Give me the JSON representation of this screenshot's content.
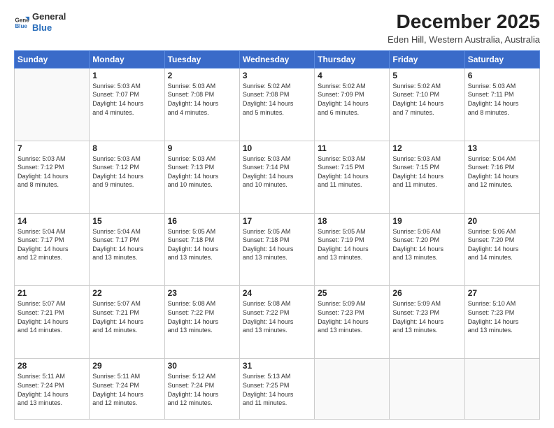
{
  "header": {
    "logo_general": "General",
    "logo_blue": "Blue",
    "title": "December 2025",
    "subtitle": "Eden Hill, Western Australia, Australia"
  },
  "calendar": {
    "days_of_week": [
      "Sunday",
      "Monday",
      "Tuesday",
      "Wednesday",
      "Thursday",
      "Friday",
      "Saturday"
    ],
    "weeks": [
      [
        {
          "day": "",
          "info": ""
        },
        {
          "day": "1",
          "info": "Sunrise: 5:03 AM\nSunset: 7:07 PM\nDaylight: 14 hours\nand 4 minutes."
        },
        {
          "day": "2",
          "info": "Sunrise: 5:03 AM\nSunset: 7:08 PM\nDaylight: 14 hours\nand 4 minutes."
        },
        {
          "day": "3",
          "info": "Sunrise: 5:02 AM\nSunset: 7:08 PM\nDaylight: 14 hours\nand 5 minutes."
        },
        {
          "day": "4",
          "info": "Sunrise: 5:02 AM\nSunset: 7:09 PM\nDaylight: 14 hours\nand 6 minutes."
        },
        {
          "day": "5",
          "info": "Sunrise: 5:02 AM\nSunset: 7:10 PM\nDaylight: 14 hours\nand 7 minutes."
        },
        {
          "day": "6",
          "info": "Sunrise: 5:03 AM\nSunset: 7:11 PM\nDaylight: 14 hours\nand 8 minutes."
        }
      ],
      [
        {
          "day": "7",
          "info": "Sunrise: 5:03 AM\nSunset: 7:12 PM\nDaylight: 14 hours\nand 8 minutes."
        },
        {
          "day": "8",
          "info": "Sunrise: 5:03 AM\nSunset: 7:12 PM\nDaylight: 14 hours\nand 9 minutes."
        },
        {
          "day": "9",
          "info": "Sunrise: 5:03 AM\nSunset: 7:13 PM\nDaylight: 14 hours\nand 10 minutes."
        },
        {
          "day": "10",
          "info": "Sunrise: 5:03 AM\nSunset: 7:14 PM\nDaylight: 14 hours\nand 10 minutes."
        },
        {
          "day": "11",
          "info": "Sunrise: 5:03 AM\nSunset: 7:15 PM\nDaylight: 14 hours\nand 11 minutes."
        },
        {
          "day": "12",
          "info": "Sunrise: 5:03 AM\nSunset: 7:15 PM\nDaylight: 14 hours\nand 11 minutes."
        },
        {
          "day": "13",
          "info": "Sunrise: 5:04 AM\nSunset: 7:16 PM\nDaylight: 14 hours\nand 12 minutes."
        }
      ],
      [
        {
          "day": "14",
          "info": "Sunrise: 5:04 AM\nSunset: 7:17 PM\nDaylight: 14 hours\nand 12 minutes."
        },
        {
          "day": "15",
          "info": "Sunrise: 5:04 AM\nSunset: 7:17 PM\nDaylight: 14 hours\nand 13 minutes."
        },
        {
          "day": "16",
          "info": "Sunrise: 5:05 AM\nSunset: 7:18 PM\nDaylight: 14 hours\nand 13 minutes."
        },
        {
          "day": "17",
          "info": "Sunrise: 5:05 AM\nSunset: 7:18 PM\nDaylight: 14 hours\nand 13 minutes."
        },
        {
          "day": "18",
          "info": "Sunrise: 5:05 AM\nSunset: 7:19 PM\nDaylight: 14 hours\nand 13 minutes."
        },
        {
          "day": "19",
          "info": "Sunrise: 5:06 AM\nSunset: 7:20 PM\nDaylight: 14 hours\nand 13 minutes."
        },
        {
          "day": "20",
          "info": "Sunrise: 5:06 AM\nSunset: 7:20 PM\nDaylight: 14 hours\nand 14 minutes."
        }
      ],
      [
        {
          "day": "21",
          "info": "Sunrise: 5:07 AM\nSunset: 7:21 PM\nDaylight: 14 hours\nand 14 minutes."
        },
        {
          "day": "22",
          "info": "Sunrise: 5:07 AM\nSunset: 7:21 PM\nDaylight: 14 hours\nand 14 minutes."
        },
        {
          "day": "23",
          "info": "Sunrise: 5:08 AM\nSunset: 7:22 PM\nDaylight: 14 hours\nand 13 minutes."
        },
        {
          "day": "24",
          "info": "Sunrise: 5:08 AM\nSunset: 7:22 PM\nDaylight: 14 hours\nand 13 minutes."
        },
        {
          "day": "25",
          "info": "Sunrise: 5:09 AM\nSunset: 7:23 PM\nDaylight: 14 hours\nand 13 minutes."
        },
        {
          "day": "26",
          "info": "Sunrise: 5:09 AM\nSunset: 7:23 PM\nDaylight: 14 hours\nand 13 minutes."
        },
        {
          "day": "27",
          "info": "Sunrise: 5:10 AM\nSunset: 7:23 PM\nDaylight: 14 hours\nand 13 minutes."
        }
      ],
      [
        {
          "day": "28",
          "info": "Sunrise: 5:11 AM\nSunset: 7:24 PM\nDaylight: 14 hours\nand 13 minutes."
        },
        {
          "day": "29",
          "info": "Sunrise: 5:11 AM\nSunset: 7:24 PM\nDaylight: 14 hours\nand 12 minutes."
        },
        {
          "day": "30",
          "info": "Sunrise: 5:12 AM\nSunset: 7:24 PM\nDaylight: 14 hours\nand 12 minutes."
        },
        {
          "day": "31",
          "info": "Sunrise: 5:13 AM\nSunset: 7:25 PM\nDaylight: 14 hours\nand 11 minutes."
        },
        {
          "day": "",
          "info": ""
        },
        {
          "day": "",
          "info": ""
        },
        {
          "day": "",
          "info": ""
        }
      ]
    ]
  }
}
